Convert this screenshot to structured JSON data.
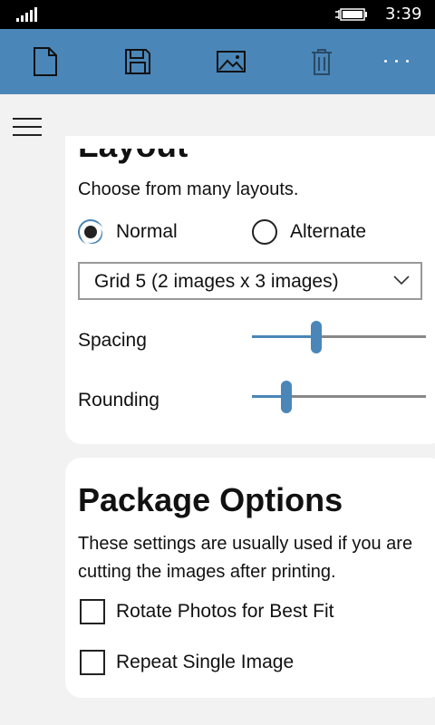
{
  "status_bar": {
    "time": "3:39",
    "icons": [
      "signal-strength-icon",
      "battery-charging-icon"
    ]
  },
  "app_bar": {
    "buttons": [
      {
        "icon": "new-document-icon"
      },
      {
        "icon": "save-icon"
      },
      {
        "icon": "image-icon"
      },
      {
        "icon": "delete-icon",
        "disabled": true
      },
      {
        "icon": "more-options-icon"
      }
    ],
    "color": "#4a86b8"
  },
  "layout": {
    "title": "Layout",
    "description": "Choose from many layouts.",
    "radio_normal": "Normal",
    "radio_alternate": "Alternate",
    "selected": "Normal",
    "dropdown_value": "Grid 5 (2 images x 3 images)",
    "spacing_label": "Spacing",
    "spacing_value": 0.37,
    "rounding_label": "Rounding",
    "rounding_value": 0.2
  },
  "package_options": {
    "title": "Package Options",
    "description": "These settings are usually used if you are cutting the images after printing.",
    "rotate_label": "Rotate Photos for Best Fit",
    "rotate_checked": false,
    "repeat_label": "Repeat Single Image",
    "repeat_checked": false
  }
}
